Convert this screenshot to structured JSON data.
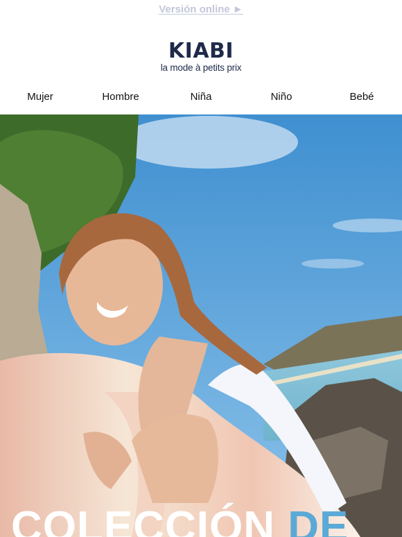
{
  "header": {
    "online_version_link": "Versión online ►"
  },
  "logo": {
    "brand": "KIABI",
    "tagline": "la mode à petits prix"
  },
  "nav": {
    "items": [
      "Mujer",
      "Hombre",
      "Niña",
      "Niño",
      "Bebé"
    ]
  },
  "hero": {
    "title_word_1": "COLECCIÓN",
    "title_word_2": "DE"
  },
  "colors": {
    "brand_navy": "#1f2a4a",
    "link_grey": "#c3c7d9",
    "title_white": "#ffffff",
    "title_blue": "#5aa9d6"
  }
}
